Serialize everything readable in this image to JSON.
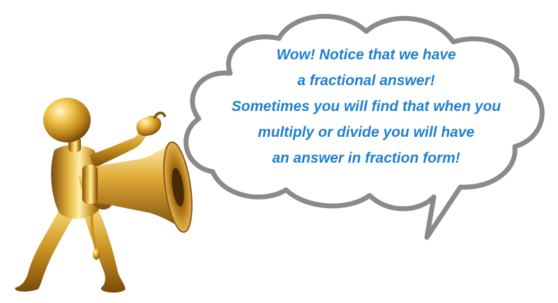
{
  "speech_bubble": {
    "lines": [
      "Wow! Notice that we have",
      "a fractional answer!",
      "Sometimes you will find that when you",
      "multiply or divide you will have",
      "an answer in fraction form!"
    ]
  },
  "colors": {
    "text": "#1f7fcf",
    "bubble_outline": "#8a8a8a",
    "figure_gold": "#d4a32a",
    "figure_shadow": "#8a5a10",
    "figure_highlight": "#fff1b0"
  },
  "icons": {
    "character": "golden-figure-with-megaphone-icon",
    "megaphone": "megaphone-icon"
  }
}
